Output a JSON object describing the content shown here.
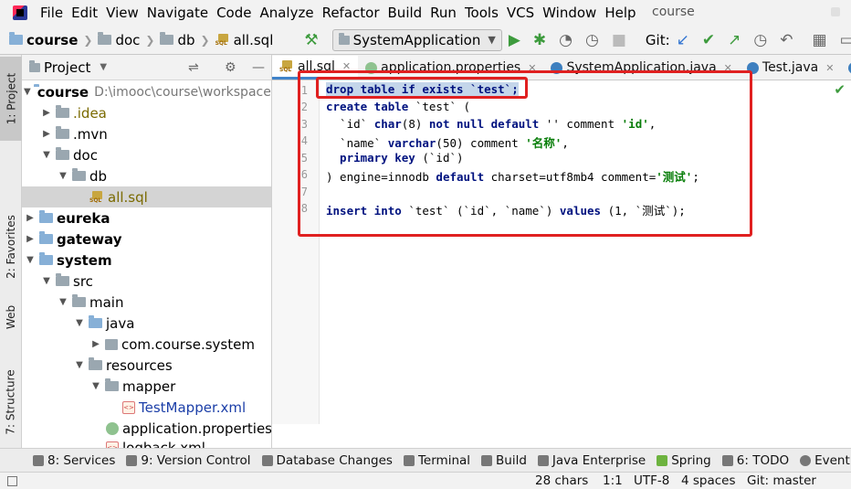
{
  "menubar": {
    "items": [
      "File",
      "Edit",
      "View",
      "Navigate",
      "Code",
      "Analyze",
      "Refactor",
      "Build",
      "Run",
      "Tools",
      "VCS",
      "Window",
      "Help"
    ],
    "project_name": "course"
  },
  "toolbar": {
    "breadcrumb": [
      "course",
      "doc",
      "db",
      "all.sql"
    ],
    "run_config": "SystemApplication",
    "git_label": "Git:"
  },
  "left_strip": {
    "tabs": [
      "1: Project",
      "2: Favorites",
      "Web",
      "7: Structure"
    ]
  },
  "project_panel": {
    "title": "Project",
    "tree": [
      {
        "label": "course",
        "extra": "D:\\imooc\\course\\workspace\\cou"
      },
      {
        "label": ".idea"
      },
      {
        "label": ".mvn"
      },
      {
        "label": "doc"
      },
      {
        "label": "db"
      },
      {
        "label": "all.sql"
      },
      {
        "label": "eureka"
      },
      {
        "label": "gateway"
      },
      {
        "label": "system"
      },
      {
        "label": "src"
      },
      {
        "label": "main"
      },
      {
        "label": "java"
      },
      {
        "label": "com.course.system"
      },
      {
        "label": "resources"
      },
      {
        "label": "mapper"
      },
      {
        "label": "TestMapper.xml"
      },
      {
        "label": "application.properties"
      },
      {
        "label": "logback.xml"
      }
    ]
  },
  "editor": {
    "tabs": [
      "all.sql",
      "application.properties",
      "SystemApplication.java",
      "Test.java"
    ],
    "line_numbers": [
      "1",
      "2",
      "3",
      "4",
      "5",
      "6",
      "7",
      "8"
    ],
    "lines": {
      "l1": "drop table if exists `test`;",
      "l2_kw": "create table",
      "l2_rest": " `test` (",
      "l3_a": "  `id` ",
      "l3_kw1": "char",
      "l3_b": "(8) ",
      "l3_kw2": "not null default",
      "l3_c": " '' comment ",
      "l3_str": "'id'",
      "l3_d": ",",
      "l4_a": "  `name` ",
      "l4_kw": "varchar",
      "l4_b": "(50) comment ",
      "l4_str": "'名称'",
      "l4_c": ",",
      "l5_kw": "  primary key",
      "l5_rest": " (`id`)",
      "l6_a": ") engine=innodb ",
      "l6_kw": "default",
      "l6_b": " charset=utf8mb4 comment=",
      "l6_str": "'测试'",
      "l6_c": ";",
      "l8_kw1": "insert into",
      "l8_a": " `test` (`id`, `name`) ",
      "l8_kw2": "values",
      "l8_b": " (1, `测试`);"
    }
  },
  "bottom_tools": [
    "8: Services",
    "9: Version Control",
    "Database Changes",
    "Terminal",
    "Build",
    "Java Enterprise",
    "Spring",
    "6: TODO",
    "Event"
  ],
  "status": {
    "chars": "28 chars",
    "position": "1:1",
    "encoding": "UTF-8",
    "indent": "4 spaces",
    "git": "Git: master"
  },
  "colors": {
    "keyword": "#00127f",
    "string": "#097e0a",
    "highlight_box": "#e02020",
    "selection": "#c4d6ea"
  }
}
